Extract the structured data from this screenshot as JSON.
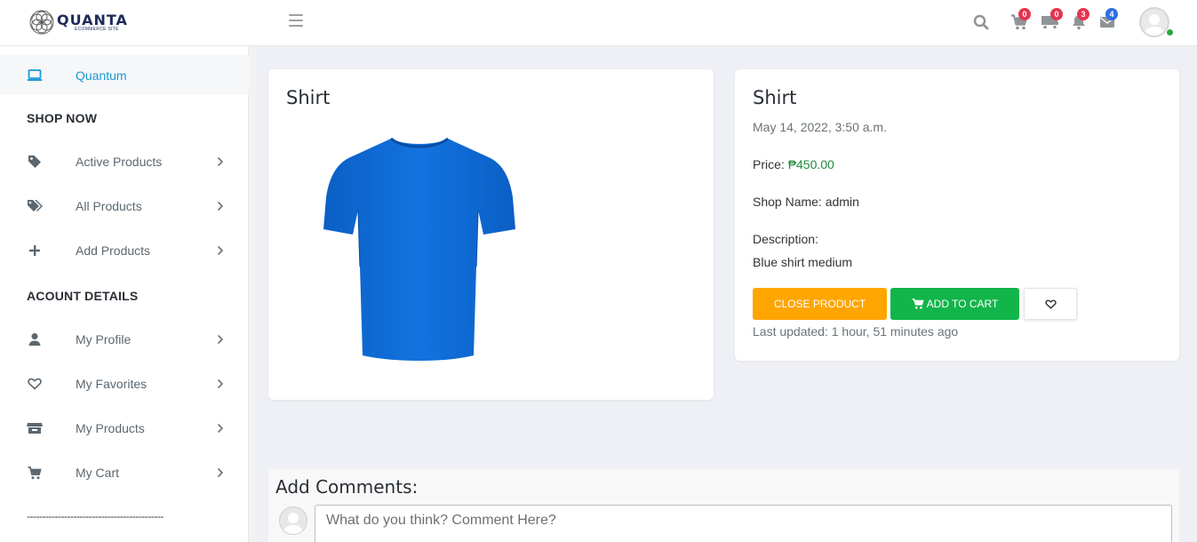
{
  "brand": {
    "name": "QUANTA",
    "tagline": "ECOMMERCE SITE"
  },
  "header": {
    "icons": [
      {
        "name": "search-icon",
        "badge": null
      },
      {
        "name": "cart-icon",
        "badge": "0",
        "badge_color": "#e8344e"
      },
      {
        "name": "truck-icon",
        "badge": "0",
        "badge_color": "#e8344e"
      },
      {
        "name": "bell-icon",
        "badge": "3",
        "badge_color": "#e8344e"
      },
      {
        "name": "envelope-icon",
        "badge": "4",
        "badge_color": "#2f6fe0"
      }
    ]
  },
  "sidebar": {
    "active": {
      "label": "Quantum",
      "icon": "laptop-icon"
    },
    "sections": [
      {
        "title": "SHOP NOW",
        "items": [
          {
            "label": "Active Products",
            "icon": "tag-icon"
          },
          {
            "label": "All Products",
            "icon": "tags-icon"
          },
          {
            "label": "Add Products",
            "icon": "plus-icon"
          }
        ]
      },
      {
        "title": "ACOUNT DETAILS",
        "items": [
          {
            "label": "My Profile",
            "icon": "user-icon"
          },
          {
            "label": "My Favorites",
            "icon": "heart-icon"
          },
          {
            "label": "My Products",
            "icon": "store-icon"
          },
          {
            "label": "My Cart",
            "icon": "cart-icon"
          }
        ]
      }
    ],
    "divider": "--------------------------------------------"
  },
  "product": {
    "image_title": "Shirt",
    "title": "Shirt",
    "date": "May 14, 2022, 3:50 a.m.",
    "price_label": "Price: ",
    "price": "₱450.00",
    "shop_label": "Shop Name: ",
    "shop_name": "admin",
    "description_label": "Description:",
    "description": "Blue shirt medium",
    "last_updated": "Last updated: 1 hour, 51 minutes ago",
    "buttons": {
      "close": "CLOSE PRODUCT",
      "add_to_cart": "ADD TO CART"
    },
    "colors": {
      "shirt": "#0f6ed8",
      "close_button": "#ffa500",
      "cart_button": "#11b54a",
      "price": "#1f8a3b",
      "active_link": "#1a9bd7"
    }
  },
  "comments": {
    "title": "Add Comments:",
    "placeholder": "What do you think? Comment Here?"
  }
}
